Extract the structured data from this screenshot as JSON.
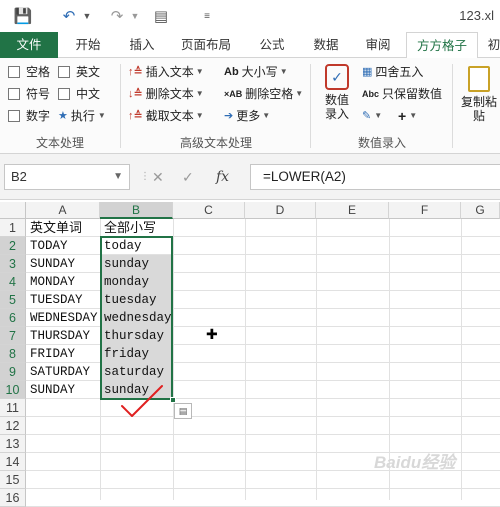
{
  "window": {
    "filename": "123.xl"
  },
  "quickaccess": {
    "save_icon": "save-icon",
    "undo_icon": "undo-icon",
    "redo_icon": "redo-icon",
    "custom_icon": "custom-icon"
  },
  "tabs": [
    "文件",
    "开始",
    "插入",
    "页面布局",
    "公式",
    "数据",
    "审阅",
    "方方格子",
    "初"
  ],
  "ribbon": {
    "text_processing": {
      "group_label": "文本处理",
      "checkboxes": [
        "空格",
        "英文",
        "符号",
        "中文",
        "数字"
      ],
      "execute": "执行"
    },
    "advanced_text": {
      "group_label": "高级文本处理",
      "items": [
        "插入文本",
        "删除文本",
        "截取文本",
        "大小写",
        "删除空格",
        "更多"
      ]
    },
    "numeric_input": {
      "group_label": "数值录入",
      "value_input": "数值录入",
      "round": "四舍五入",
      "keep_value": "只保留数值",
      "plus": "+"
    },
    "paste": {
      "label": "复制粘贴"
    }
  },
  "formula_bar": {
    "name_box": "B2",
    "fx": "fx",
    "formula": "=LOWER(A2)"
  },
  "columns": [
    "A",
    "B",
    "C",
    "D",
    "E",
    "F",
    "G"
  ],
  "rows": [
    "1",
    "2",
    "3",
    "4",
    "5",
    "6",
    "7",
    "8",
    "9",
    "10",
    "11",
    "12",
    "13",
    "14",
    "15",
    "16"
  ],
  "cells_a": [
    "英文单词",
    "TODAY",
    "SUNDAY",
    "MONDAY",
    "TUESDAY",
    "WEDNESDAY",
    "THURSDAY",
    "FRIDAY",
    "SATURDAY",
    "SUNDAY"
  ],
  "cells_b": [
    "全部小写",
    "today",
    "sunday",
    "monday",
    "tuesday",
    "wednesday",
    "thursday",
    "friday",
    "saturday",
    "sunday"
  ],
  "watermark": "Baidu经验"
}
